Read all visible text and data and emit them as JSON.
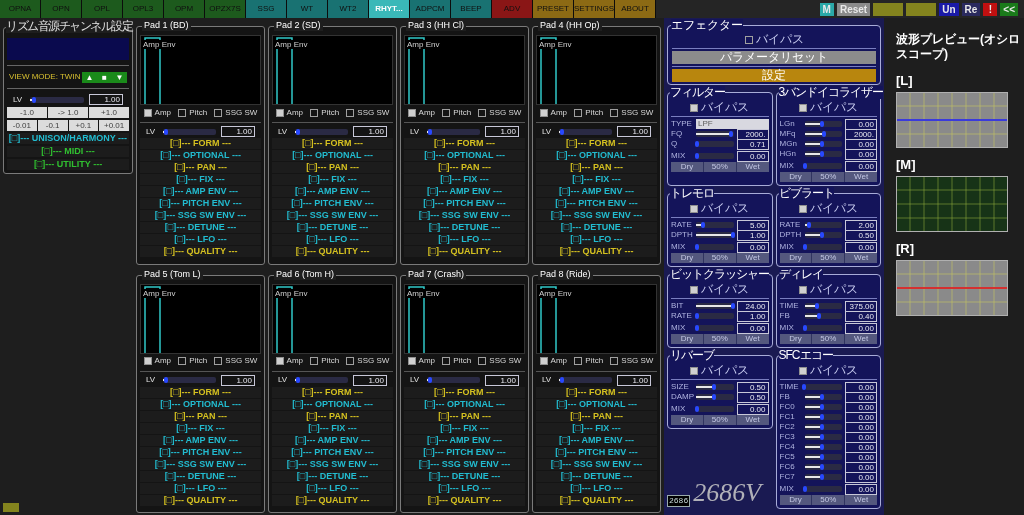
{
  "top_tabs": [
    {
      "label": "OPNA",
      "color": "#1d5a1d",
      "selected": false
    },
    {
      "label": "OPN",
      "color": "#1d5a1d",
      "selected": false
    },
    {
      "label": "OPL",
      "color": "#1d5a1d",
      "selected": false
    },
    {
      "label": "OPL3",
      "color": "#1d5a1d",
      "selected": false
    },
    {
      "label": "OPM",
      "color": "#1d5a1d",
      "selected": false
    },
    {
      "label": "OPZX7S",
      "color": "#1d5a1d",
      "selected": false
    },
    {
      "label": "SSG",
      "color": "#197272",
      "selected": false
    },
    {
      "label": "WT",
      "color": "#197272",
      "selected": false
    },
    {
      "label": "WT2",
      "color": "#197272",
      "selected": false
    },
    {
      "label": "RHYT...",
      "color": "#3ab8b8",
      "selected": true
    },
    {
      "label": "ADPCM",
      "color": "#197272",
      "selected": false
    },
    {
      "label": "BEEP",
      "color": "#197272",
      "selected": false
    },
    {
      "label": "ADV",
      "color": "#8a1616",
      "selected": false
    },
    {
      "label": "PRESET",
      "color": "#8c6a14",
      "selected": false
    },
    {
      "label": "SETTINGS",
      "color": "#8c6a14",
      "selected": false
    },
    {
      "label": "ABOUT",
      "color": "#8c6a14",
      "selected": false
    }
  ],
  "toolbar_buttons": [
    {
      "label": "M",
      "color": "#2aa8a8"
    },
    {
      "label": "Reset",
      "color": "#8a8a8a"
    },
    {
      "color": "#84841e"
    },
    {
      "color": "#84841e"
    },
    {
      "label": "Un",
      "color": "#1a1aa8"
    },
    {
      "label": "Re",
      "color": "#2a2a5e"
    },
    {
      "label": "!",
      "color": "#c01010"
    },
    {
      "label": "<<",
      "color": "#1a7a1a"
    }
  ],
  "channel_panel": {
    "title": "リズム音源チャンネル設定",
    "view_mode": "VIEW MODE: TWIN",
    "view_buttons": [
      "▲",
      "■",
      "▼"
    ],
    "lv": {
      "label": "LV",
      "level": 0.1,
      "value": "1.00"
    },
    "step_rows": [
      [
        "-1.0",
        "-> 1.0",
        "+1.0"
      ],
      [
        "-0.01",
        "-0.1",
        "+0.1",
        "+0.01"
      ]
    ],
    "sections": [
      {
        "label": "[□]--- UNISON/HARMONY ---",
        "color": "#22bcd0"
      },
      {
        "label": "[□]--- MIDI ---",
        "color": "#30c030"
      },
      {
        "label": "[□]--- UTILITY ---",
        "color": "#30c030"
      }
    ]
  },
  "pads": [
    {
      "title": "Pad 1 (BD)",
      "env_label": "Amp Env",
      "toggles": [
        {
          "label": "Amp",
          "checked": true
        },
        {
          "label": "Pitch",
          "checked": false
        },
        {
          "label": "SSG SW",
          "checked": false
        }
      ],
      "lv": {
        "label": "LV",
        "level": 0.08,
        "value": "1.00"
      },
      "sections": [
        {
          "label": "[□]--- FORM ---",
          "color": "#d4c020"
        },
        {
          "label": "[□]--- OPTIONAL ---",
          "color": "#22bcd0"
        },
        {
          "label": "[□]--- PAN ---",
          "color": "#d4c020"
        },
        {
          "label": "[□]--- FIX ---",
          "color": "#22bcd0"
        },
        {
          "label": "[□]--- AMP ENV ---",
          "color": "#22bcd0"
        },
        {
          "label": "[□]--- PITCH ENV ---",
          "color": "#22bcd0"
        },
        {
          "label": "[□]--- SSG SW ENV ---",
          "color": "#22bcd0"
        },
        {
          "label": "[□]--- DETUNE ---",
          "color": "#22bcd0"
        },
        {
          "label": "[□]--- LFO ---",
          "color": "#22bcd0"
        },
        {
          "label": "[□]--- QUALITY ---",
          "color": "#d4c020"
        }
      ]
    },
    {
      "title": "Pad 2 (SD)",
      "env_label": "Amp Env",
      "toggles": [
        {
          "label": "Amp",
          "checked": true
        },
        {
          "label": "Pitch",
          "checked": false
        },
        {
          "label": "SSG SW",
          "checked": false
        }
      ],
      "lv": {
        "label": "LV",
        "level": 0.08,
        "value": "1.00"
      },
      "sections": [
        {
          "label": "[□]--- FORM ---",
          "color": "#d4c020"
        },
        {
          "label": "[□]--- OPTIONAL ---",
          "color": "#22bcd0"
        },
        {
          "label": "[□]--- PAN ---",
          "color": "#d4c020"
        },
        {
          "label": "[□]--- FIX ---",
          "color": "#22bcd0"
        },
        {
          "label": "[□]--- AMP ENV ---",
          "color": "#22bcd0"
        },
        {
          "label": "[□]--- PITCH ENV ---",
          "color": "#22bcd0"
        },
        {
          "label": "[□]--- SSG SW ENV ---",
          "color": "#22bcd0"
        },
        {
          "label": "[□]--- DETUNE ---",
          "color": "#22bcd0"
        },
        {
          "label": "[□]--- LFO ---",
          "color": "#22bcd0"
        },
        {
          "label": "[□]--- QUALITY ---",
          "color": "#d4c020"
        }
      ]
    },
    {
      "title": "Pad 3 (HH Cl)",
      "env_label": "Amp Env",
      "toggles": [
        {
          "label": "Amp",
          "checked": true
        },
        {
          "label": "Pitch",
          "checked": false
        },
        {
          "label": "SSG SW",
          "checked": false
        }
      ],
      "lv": {
        "label": "LV",
        "level": 0.08,
        "value": "1.00"
      },
      "sections": [
        {
          "label": "[□]--- FORM ---",
          "color": "#d4c020"
        },
        {
          "label": "[□]--- OPTIONAL ---",
          "color": "#22bcd0"
        },
        {
          "label": "[□]--- PAN ---",
          "color": "#d4c020"
        },
        {
          "label": "[□]--- FIX ---",
          "color": "#22bcd0"
        },
        {
          "label": "[□]--- AMP ENV ---",
          "color": "#22bcd0"
        },
        {
          "label": "[□]--- PITCH ENV ---",
          "color": "#22bcd0"
        },
        {
          "label": "[□]--- SSG SW ENV ---",
          "color": "#22bcd0"
        },
        {
          "label": "[□]--- DETUNE ---",
          "color": "#22bcd0"
        },
        {
          "label": "[□]--- LFO ---",
          "color": "#22bcd0"
        },
        {
          "label": "[□]--- QUALITY ---",
          "color": "#d4c020"
        }
      ]
    },
    {
      "title": "Pad 4 (HH Op)",
      "env_label": "Amp Env",
      "toggles": [
        {
          "label": "Amp",
          "checked": true
        },
        {
          "label": "Pitch",
          "checked": false
        },
        {
          "label": "SSG SW",
          "checked": false
        }
      ],
      "lv": {
        "label": "LV",
        "level": 0.08,
        "value": "1.00"
      },
      "sections": [
        {
          "label": "[□]--- FORM ---",
          "color": "#d4c020"
        },
        {
          "label": "[□]--- OPTIONAL ---",
          "color": "#22bcd0"
        },
        {
          "label": "[□]--- PAN ---",
          "color": "#d4c020"
        },
        {
          "label": "[□]--- FIX ---",
          "color": "#22bcd0"
        },
        {
          "label": "[□]--- AMP ENV ---",
          "color": "#22bcd0"
        },
        {
          "label": "[□]--- PITCH ENV ---",
          "color": "#22bcd0"
        },
        {
          "label": "[□]--- SSG SW ENV ---",
          "color": "#22bcd0"
        },
        {
          "label": "[□]--- DETUNE ---",
          "color": "#22bcd0"
        },
        {
          "label": "[□]--- LFO ---",
          "color": "#22bcd0"
        },
        {
          "label": "[□]--- QUALITY ---",
          "color": "#d4c020"
        }
      ]
    },
    {
      "title": "Pad 5 (Tom L)",
      "env_label": "Amp Env",
      "toggles": [
        {
          "label": "Amp",
          "checked": true
        },
        {
          "label": "Pitch",
          "checked": false
        },
        {
          "label": "SSG SW",
          "checked": false
        }
      ],
      "lv": {
        "label": "LV",
        "level": 0.08,
        "value": "1.00"
      },
      "sections": [
        {
          "label": "[□]--- FORM ---",
          "color": "#d4c020"
        },
        {
          "label": "[□]--- OPTIONAL ---",
          "color": "#22bcd0"
        },
        {
          "label": "[□]--- PAN ---",
          "color": "#d4c020"
        },
        {
          "label": "[□]--- FIX ---",
          "color": "#22bcd0"
        },
        {
          "label": "[□]--- AMP ENV ---",
          "color": "#22bcd0"
        },
        {
          "label": "[□]--- PITCH ENV ---",
          "color": "#22bcd0"
        },
        {
          "label": "[□]--- SSG SW ENV ---",
          "color": "#22bcd0"
        },
        {
          "label": "[□]--- DETUNE ---",
          "color": "#22bcd0"
        },
        {
          "label": "[□]--- LFO ---",
          "color": "#22bcd0"
        },
        {
          "label": "[□]--- QUALITY ---",
          "color": "#d4c020"
        }
      ]
    },
    {
      "title": "Pad 6 (Tom H)",
      "env_label": "Amp Env",
      "toggles": [
        {
          "label": "Amp",
          "checked": true
        },
        {
          "label": "Pitch",
          "checked": false
        },
        {
          "label": "SSG SW",
          "checked": false
        }
      ],
      "lv": {
        "label": "LV",
        "level": 0.08,
        "value": "1.00"
      },
      "sections": [
        {
          "label": "[□]--- FORM ---",
          "color": "#d4c020"
        },
        {
          "label": "[□]--- OPTIONAL ---",
          "color": "#22bcd0"
        },
        {
          "label": "[□]--- PAN ---",
          "color": "#d4c020"
        },
        {
          "label": "[□]--- FIX ---",
          "color": "#22bcd0"
        },
        {
          "label": "[□]--- AMP ENV ---",
          "color": "#22bcd0"
        },
        {
          "label": "[□]--- PITCH ENV ---",
          "color": "#22bcd0"
        },
        {
          "label": "[□]--- SSG SW ENV ---",
          "color": "#22bcd0"
        },
        {
          "label": "[□]--- DETUNE ---",
          "color": "#22bcd0"
        },
        {
          "label": "[□]--- LFO ---",
          "color": "#22bcd0"
        },
        {
          "label": "[□]--- QUALITY ---",
          "color": "#d4c020"
        }
      ]
    },
    {
      "title": "Pad 7 (Crash)",
      "env_label": "Amp Env",
      "toggles": [
        {
          "label": "Amp",
          "checked": true
        },
        {
          "label": "Pitch",
          "checked": false
        },
        {
          "label": "SSG SW",
          "checked": false
        }
      ],
      "lv": {
        "label": "LV",
        "level": 0.08,
        "value": "1.00"
      },
      "sections": [
        {
          "label": "[□]--- FORM ---",
          "color": "#d4c020"
        },
        {
          "label": "[□]--- OPTIONAL ---",
          "color": "#22bcd0"
        },
        {
          "label": "[□]--- PAN ---",
          "color": "#d4c020"
        },
        {
          "label": "[□]--- FIX ---",
          "color": "#22bcd0"
        },
        {
          "label": "[□]--- AMP ENV ---",
          "color": "#22bcd0"
        },
        {
          "label": "[□]--- PITCH ENV ---",
          "color": "#22bcd0"
        },
        {
          "label": "[□]--- SSG SW ENV ---",
          "color": "#22bcd0"
        },
        {
          "label": "[□]--- DETUNE ---",
          "color": "#22bcd0"
        },
        {
          "label": "[□]--- LFO ---",
          "color": "#22bcd0"
        },
        {
          "label": "[□]--- QUALITY ---",
          "color": "#d4c020"
        }
      ]
    },
    {
      "title": "Pad 8 (Ride)",
      "env_label": "Amp Env",
      "toggles": [
        {
          "label": "Amp",
          "checked": true
        },
        {
          "label": "Pitch",
          "checked": false
        },
        {
          "label": "SSG SW",
          "checked": false
        }
      ],
      "lv": {
        "label": "LV",
        "level": 0.08,
        "value": "1.00"
      },
      "sections": [
        {
          "label": "[□]--- FORM ---",
          "color": "#d4c020"
        },
        {
          "label": "[□]--- OPTIONAL ---",
          "color": "#22bcd0"
        },
        {
          "label": "[□]--- PAN ---",
          "color": "#d4c020"
        },
        {
          "label": "[□]--- FIX ---",
          "color": "#22bcd0"
        },
        {
          "label": "[□]--- AMP ENV ---",
          "color": "#22bcd0"
        },
        {
          "label": "[□]--- PITCH ENV ---",
          "color": "#22bcd0"
        },
        {
          "label": "[□]--- SSG SW ENV ---",
          "color": "#22bcd0"
        },
        {
          "label": "[□]--- DETUNE ---",
          "color": "#22bcd0"
        },
        {
          "label": "[□]--- LFO ---",
          "color": "#22bcd0"
        },
        {
          "label": "[□]--- QUALITY ---",
          "color": "#d4c020"
        }
      ]
    }
  ],
  "effector": {
    "title": "エフェクター",
    "bypass": {
      "label": "バイパス",
      "checked": false
    },
    "buttons": [
      {
        "label": "パラメータリセット",
        "kind": "reset"
      },
      {
        "label": "設定",
        "kind": "settings"
      }
    ]
  },
  "effects": [
    {
      "title": "フィルター",
      "bypass": {
        "label": "バイパス",
        "checked": true
      },
      "params": [
        {
          "kind": "select",
          "label": "TYPE",
          "value": "LPF"
        },
        {
          "kind": "slider",
          "label": "FQ",
          "level": 0.95,
          "value": "2000."
        },
        {
          "kind": "slider",
          "label": "Q",
          "level": 0.05,
          "value": "0.71"
        }
      ],
      "mix": {
        "label": "MIX",
        "level": 0.05,
        "value": "0.00"
      },
      "mix_buttons": {
        "disabled": true,
        "labels": [
          "Dry",
          "50%",
          "Wet"
        ]
      }
    },
    {
      "title": "3バンドイコライザー",
      "bypass": {
        "label": "バイパス",
        "checked": true
      },
      "params": [
        {
          "kind": "slider",
          "label": "LGn",
          "level": 0.5,
          "value": "0.00"
        },
        {
          "kind": "slider",
          "label": "MFq",
          "level": 0.55,
          "value": "2000."
        },
        {
          "kind": "slider",
          "label": "MGn",
          "level": 0.5,
          "value": "0.00"
        },
        {
          "kind": "slider",
          "label": "HGn",
          "level": 0.5,
          "value": "0.00"
        }
      ],
      "mix": {
        "label": "MIX",
        "level": 0.05,
        "value": "0.00"
      },
      "mix_buttons": {
        "disabled": true,
        "labels": [
          "Dry",
          "50%",
          "Wet"
        ]
      }
    },
    {
      "title": "トレモロ",
      "bypass": {
        "label": "バイパス",
        "checked": true
      },
      "params": [
        {
          "kind": "slider",
          "label": "RATE",
          "level": 0.2,
          "value": "5.00"
        },
        {
          "kind": "slider",
          "label": "DPTH",
          "level": 1,
          "value": "1.00"
        }
      ],
      "mix": {
        "label": "MIX",
        "level": 0.05,
        "value": "0.00"
      },
      "mix_buttons": {
        "disabled": true,
        "labels": [
          "Dry",
          "50%",
          "Wet"
        ]
      }
    },
    {
      "title": "ビブラート",
      "bypass": {
        "label": "バイパス",
        "checked": true
      },
      "params": [
        {
          "kind": "slider",
          "label": "RATE",
          "level": 0.15,
          "value": "2.00"
        },
        {
          "kind": "slider",
          "label": "DPTH",
          "level": 0.5,
          "value": "0.50"
        }
      ],
      "mix": {
        "label": "MIX",
        "level": 0.05,
        "value": "0.00"
      },
      "mix_buttons": {
        "disabled": true,
        "labels": [
          "Dry",
          "50%",
          "Wet"
        ]
      }
    },
    {
      "title": "ビットクラッシャー",
      "bypass": {
        "label": "バイパス",
        "checked": true
      },
      "params": [
        {
          "kind": "slider",
          "label": "BIT",
          "level": 1,
          "value": "24.00"
        },
        {
          "kind": "slider",
          "label": "RATE",
          "level": 0.05,
          "value": "1.00"
        }
      ],
      "mix": {
        "label": "MIX",
        "level": 0.05,
        "value": "0.00"
      },
      "mix_buttons": {
        "disabled": true,
        "labels": [
          "Dry",
          "50%",
          "Wet"
        ]
      }
    },
    {
      "title": "ディレイ",
      "bypass": {
        "label": "バイパス",
        "checked": true
      },
      "params": [
        {
          "kind": "slider",
          "label": "TIME",
          "level": 0.35,
          "value": "375.00"
        },
        {
          "kind": "slider",
          "label": "FB",
          "level": 0.4,
          "value": "0.40"
        }
      ],
      "mix": {
        "label": "MIX",
        "level": 0.05,
        "value": "0.00"
      },
      "mix_buttons": {
        "disabled": true,
        "labels": [
          "Dry",
          "50%",
          "Wet"
        ]
      }
    },
    {
      "title": "リバーブ",
      "bypass": {
        "label": "バイパス",
        "checked": true
      },
      "params": [
        {
          "kind": "slider",
          "label": "SIZE",
          "level": 0.5,
          "value": "0.50"
        },
        {
          "kind": "slider",
          "label": "DAMP",
          "level": 0.5,
          "value": "0.50"
        }
      ],
      "mix": {
        "label": "MIX",
        "level": 0.05,
        "value": "0.00"
      },
      "mix_buttons": {
        "disabled": true,
        "labels": [
          "Dry",
          "50%",
          "Wet"
        ]
      }
    },
    {
      "title": "SFCエコー",
      "bypass": {
        "label": "バイパス",
        "checked": true
      },
      "params": [
        {
          "kind": "slider",
          "label": "TIME",
          "level": 0.02,
          "value": "0.00"
        },
        {
          "kind": "slider",
          "label": "FB",
          "level": 0.5,
          "value": "0.00"
        },
        {
          "kind": "slider",
          "label": "FC0",
          "level": 0.5,
          "value": "0.00"
        },
        {
          "kind": "slider",
          "label": "FC1",
          "level": 0.5,
          "value": "0.00"
        },
        {
          "kind": "slider",
          "label": "FC2",
          "level": 0.5,
          "value": "0.00"
        },
        {
          "kind": "slider",
          "label": "FC3",
          "level": 0.5,
          "value": "0.00"
        },
        {
          "kind": "slider",
          "label": "FC4",
          "level": 0.5,
          "value": "0.00"
        },
        {
          "kind": "slider",
          "label": "FC5",
          "level": 0.5,
          "value": "0.00"
        },
        {
          "kind": "slider",
          "label": "FC6",
          "level": 0.5,
          "value": "0.00"
        },
        {
          "kind": "slider",
          "label": "FC7",
          "level": 0.5,
          "value": "0.00"
        }
      ],
      "mix": {
        "label": "MIX",
        "level": 0.05,
        "value": "0.00"
      },
      "mix_buttons": {
        "disabled": true,
        "labels": [
          "Dry",
          "50%",
          "Wet"
        ]
      }
    }
  ],
  "logo": {
    "badge": "2686",
    "text": "2686V"
  },
  "scope_panel": {
    "title": "波形プレビュー(オシロスコープ)",
    "scopes": [
      {
        "label": "[L]",
        "kind": "gray",
        "color": "#3a3adc"
      },
      {
        "label": "[M]",
        "kind": "green"
      },
      {
        "label": "[R]",
        "kind": "gray",
        "color": "#d43030"
      }
    ]
  }
}
